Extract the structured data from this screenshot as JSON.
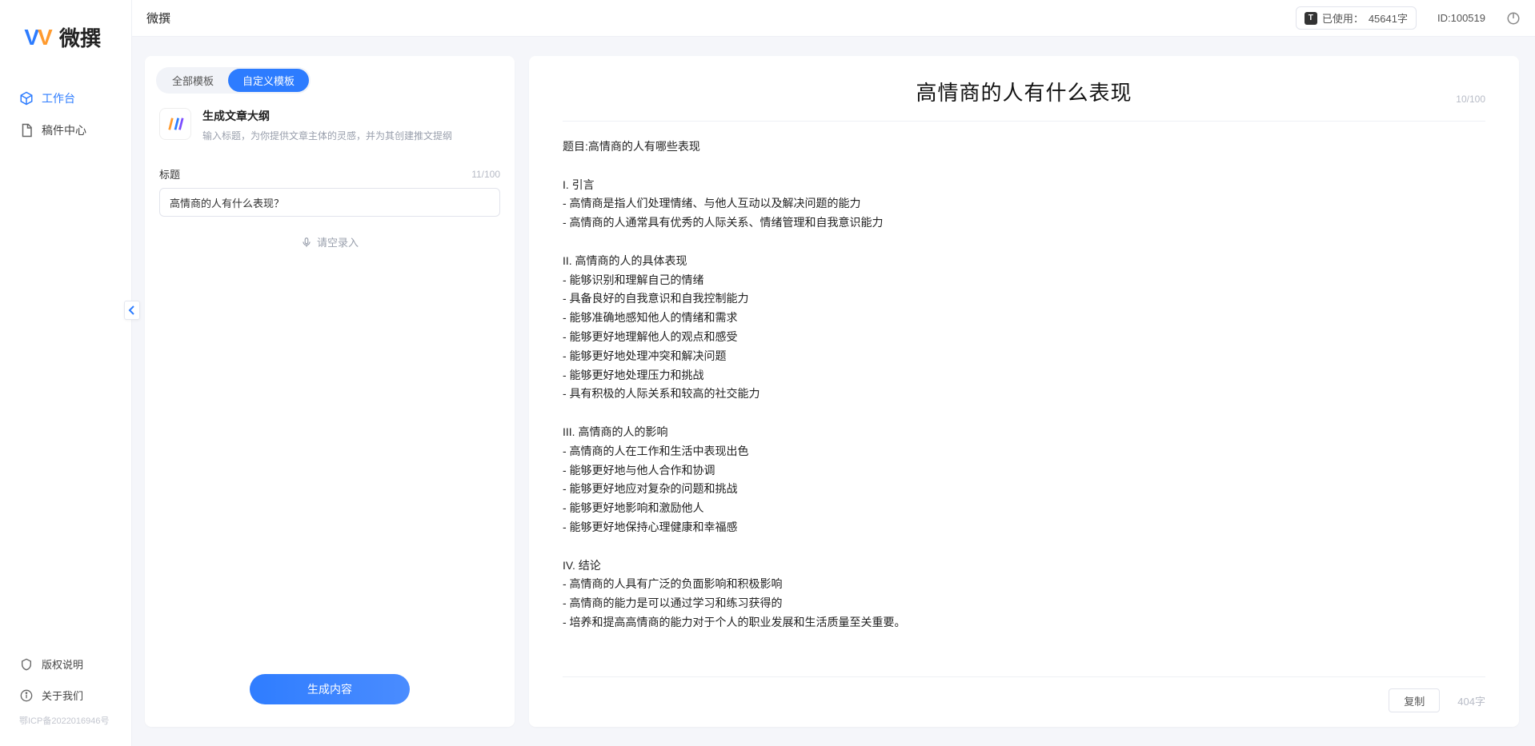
{
  "app": {
    "name": "微撰",
    "logo_text": "微撰"
  },
  "sidebar": {
    "items": [
      {
        "label": "工作台",
        "icon": "cube",
        "active": true
      },
      {
        "label": "稿件中心",
        "icon": "doc",
        "active": false
      }
    ],
    "bottom": [
      {
        "label": "版权说明",
        "icon": "shield"
      },
      {
        "label": "关于我们",
        "icon": "info"
      }
    ],
    "icp": "鄂ICP备2022016946号"
  },
  "topbar": {
    "title": "微撰",
    "usage_label": "已使用：",
    "usage_value": "45641字",
    "user_id_label": "ID:",
    "user_id": "100519"
  },
  "left": {
    "tabs": [
      {
        "label": "全部模板",
        "active": false
      },
      {
        "label": "自定义模板",
        "active": true
      }
    ],
    "template": {
      "title": "生成文章大纲",
      "desc": "输入标题，为你提供文章主体的灵感，并为其创建推文提纲"
    },
    "form": {
      "label": "标题",
      "value": "高情商的人有什么表现？",
      "char_count": "11/100",
      "voice_label": "请空录入"
    },
    "generate_btn": "生成内容"
  },
  "right": {
    "title": "高情商的人有什么表现",
    "title_count": "10/100",
    "body": "题目:高情商的人有哪些表现\n\nI. 引言\n- 高情商是指人们处理情绪、与他人互动以及解决问题的能力\n- 高情商的人通常具有优秀的人际关系、情绪管理和自我意识能力\n\nII. 高情商的人的具体表现\n- 能够识别和理解自己的情绪\n- 具备良好的自我意识和自我控制能力\n- 能够准确地感知他人的情绪和需求\n- 能够更好地理解他人的观点和感受\n- 能够更好地处理冲突和解决问题\n- 能够更好地处理压力和挑战\n- 具有积极的人际关系和较高的社交能力\n\nIII. 高情商的人的影响\n- 高情商的人在工作和生活中表现出色\n- 能够更好地与他人合作和协调\n- 能够更好地应对复杂的问题和挑战\n- 能够更好地影响和激励他人\n- 能够更好地保持心理健康和幸福感\n\nIV. 结论\n- 高情商的人具有广泛的负面影响和积极影响\n- 高情商的能力是可以通过学习和练习获得的\n- 培养和提高高情商的能力对于个人的职业发展和生活质量至关重要。",
    "copy_btn": "复制",
    "word_count": "404字"
  }
}
